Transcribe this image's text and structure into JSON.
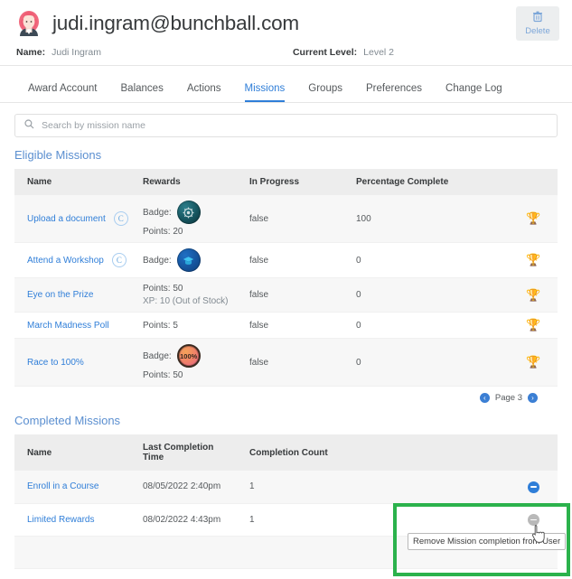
{
  "header": {
    "email": "judi.ingram@bunchball.com",
    "avatar_icon": "user-avatar-woman",
    "name_label": "Name:",
    "name_value": "Judi Ingram",
    "level_label": "Current Level:",
    "level_value": "Level 2",
    "delete_label": "Delete",
    "delete_icon": "trash-icon"
  },
  "tabs": [
    {
      "label": "Award Account",
      "active": false
    },
    {
      "label": "Balances",
      "active": false
    },
    {
      "label": "Actions",
      "active": false
    },
    {
      "label": "Missions",
      "active": true
    },
    {
      "label": "Groups",
      "active": false
    },
    {
      "label": "Preferences",
      "active": false
    },
    {
      "label": "Change Log",
      "active": false
    }
  ],
  "search": {
    "placeholder": "Search by mission name",
    "value": "",
    "icon": "search-icon"
  },
  "eligible": {
    "title": "Eligible Missions",
    "columns": [
      "Name",
      "Rewards",
      "In Progress",
      "Percentage Complete",
      ""
    ],
    "rows": [
      {
        "name": "Upload a document",
        "recurring": true,
        "recur_icon": "recurring-circle-icon",
        "badge_label": "Badge:",
        "badge_icon": "badge-gear",
        "badge_text": "",
        "points": "Points: 20",
        "xp": "",
        "in_progress": "false",
        "percentage": "100",
        "action_icon": "trophy-icon"
      },
      {
        "name": "Attend a Workshop",
        "recurring": true,
        "recur_icon": "recurring-circle-icon",
        "badge_label": "Badge:",
        "badge_icon": "badge-graduation-cap",
        "badge_text": "",
        "points": "",
        "xp": "",
        "in_progress": "false",
        "percentage": "0",
        "action_icon": "trophy-icon"
      },
      {
        "name": "Eye on the Prize",
        "recurring": false,
        "recur_icon": "",
        "badge_label": "",
        "badge_icon": "",
        "badge_text": "",
        "points": "Points: 50",
        "xp": "XP: 10 (Out of Stock)",
        "in_progress": "false",
        "percentage": "0",
        "action_icon": "trophy-icon"
      },
      {
        "name": "March Madness Poll",
        "recurring": false,
        "recur_icon": "",
        "badge_label": "",
        "badge_icon": "",
        "badge_text": "",
        "points": "Points: 5",
        "xp": "",
        "in_progress": "false",
        "percentage": "0",
        "action_icon": "trophy-icon"
      },
      {
        "name": "Race to 100%",
        "recurring": false,
        "recur_icon": "",
        "badge_label": "Badge:",
        "badge_icon": "badge-100-percent",
        "badge_text": "100%",
        "points": "Points: 50",
        "xp": "",
        "in_progress": "false",
        "percentage": "0",
        "action_icon": "trophy-icon"
      }
    ],
    "pager": {
      "prev_icon": "chevron-left-circle-icon",
      "next_icon": "chevron-right-circle-icon",
      "label": "Page 3"
    }
  },
  "completed": {
    "title": "Completed Missions",
    "columns": [
      "Name",
      "Last Completion Time",
      "Completion Count",
      ""
    ],
    "rows": [
      {
        "name": "Enroll in a Course",
        "last_completion": "08/05/2022 2:40pm",
        "count": "1",
        "action_icon": "remove-circle-icon",
        "hovered": true
      },
      {
        "name": "Limited Rewards",
        "last_completion": "08/02/2022 4:43pm",
        "count": "1",
        "action_icon": "remove-circle-icon",
        "hovered": false
      }
    ]
  },
  "overlay": {
    "tooltip_text": "Remove Mission completion from User",
    "highlight_color": "#2bb24c",
    "cursor_icon": "pointer-cursor"
  }
}
